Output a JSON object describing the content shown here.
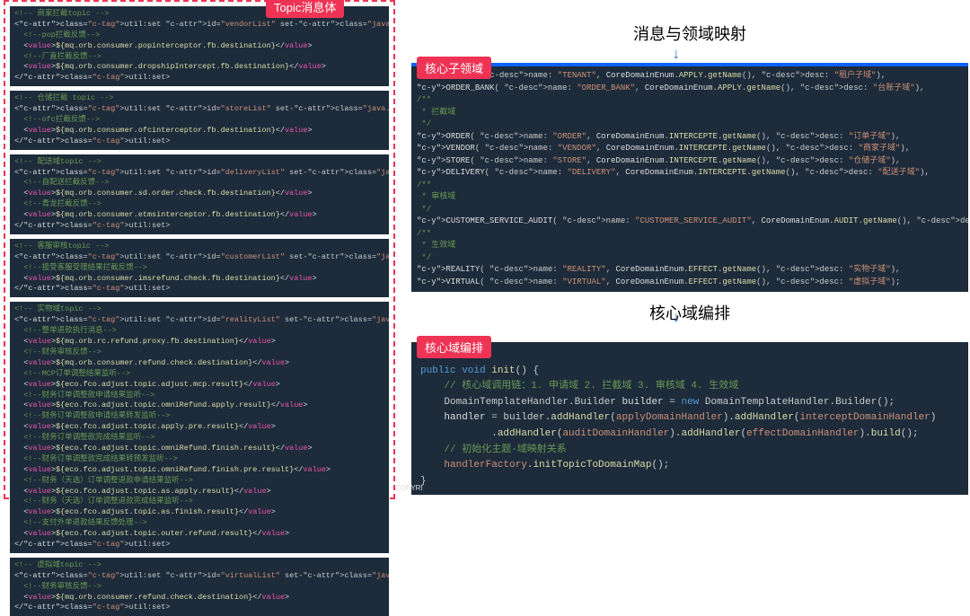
{
  "labels": {
    "topic": "Topic消息体",
    "subdomain": "核心子领域",
    "orchestration": "核心域编排"
  },
  "titles": {
    "mapping": "消息与领域映射",
    "orchestration": "核心域编排"
  },
  "left_blocks": [
    {
      "lines": [
        {
          "kind": "cmt",
          "text": "<!-- 商家拦截topic -->"
        },
        {
          "kind": "tag",
          "text": "<util:set id=\"vendorList\" set-class=\"java.util.HashSet\">"
        },
        {
          "kind": "cmt",
          "text": "  <!--pop拦截反馈-->"
        },
        {
          "kind": "val",
          "text": "  <value>${mq.orb.consumer.popinterceptor.fb.destination}</value>"
        },
        {
          "kind": "cmt",
          "text": "  <!--厂直拦截反馈-->"
        },
        {
          "kind": "val",
          "text": "  <value>${mq.orb.consumer.dropshipIntercept.fb.destination}</value>"
        },
        {
          "kind": "tag",
          "text": "</util:set>"
        }
      ]
    },
    {
      "lines": [
        {
          "kind": "cmt",
          "text": "<!-- 仓储拦截 topic -->"
        },
        {
          "kind": "tag",
          "text": "<util:set id=\"storeList\" set-class=\"java.util.HashSet\">"
        },
        {
          "kind": "cmt",
          "text": "  <!--ofc拦截反馈-->"
        },
        {
          "kind": "val",
          "text": "  <value>${mq.orb.consumer.ofcinterceptor.fb.destination}</value>"
        },
        {
          "kind": "tag",
          "text": "</util:set>"
        }
      ]
    },
    {
      "lines": [
        {
          "kind": "cmt",
          "text": "<!-- 配送域topic -->"
        },
        {
          "kind": "tag",
          "text": "<util:set id=\"deliveryList\" set-class=\"java.util.HashSet\">"
        },
        {
          "kind": "cmt",
          "text": "  <!--自配送拦截反馈-->"
        },
        {
          "kind": "val",
          "text": "  <value>${mq.orb.consumer.sd.order.check.fb.destination}</value>"
        },
        {
          "kind": "cmt",
          "text": "  <!--青龙拦截反馈-->"
        },
        {
          "kind": "val",
          "text": "  <value>${mq.orb.consumer.etmsinterceptor.fb.destination}</value>"
        },
        {
          "kind": "tag",
          "text": "</util:set>"
        }
      ]
    },
    {
      "lines": [
        {
          "kind": "cmt",
          "text": "<!-- 客服审核topic -->"
        },
        {
          "kind": "tag",
          "text": "<util:set id=\"customerList\" set-class=\"java.util.HashSet\">"
        },
        {
          "kind": "cmt",
          "text": "  <!--接受客服受理结果拦截反馈-->"
        },
        {
          "kind": "val",
          "text": "  <value>${mq.orb.consumer.imsrefund.check.fb.destination}</value>"
        },
        {
          "kind": "tag",
          "text": "</util:set>"
        }
      ]
    },
    {
      "lines": [
        {
          "kind": "cmt",
          "text": "<!-- 实物域topic -->"
        },
        {
          "kind": "tag",
          "text": "<util:set id=\"realityList\" set-class=\"java.util.HashSet\">"
        },
        {
          "kind": "cmt",
          "text": "  <!--整单退款执行消息-->"
        },
        {
          "kind": "val",
          "text": "  <value>${mq.orb.rc.refund.proxy.fb.destination}</value>"
        },
        {
          "kind": "cmt",
          "text": "  <!--财务审核反馈-->"
        },
        {
          "kind": "val",
          "text": "  <value>${mq.orb.consumer.refund.check.destination}</value>"
        },
        {
          "kind": "cmt",
          "text": "  <!--MCP订单调整结果监听-->"
        },
        {
          "kind": "val",
          "text": "  <value>${eco.fco.adjust.topic.adjust.mcp.result}</value>"
        },
        {
          "kind": "cmt",
          "text": "  <!--财务订单调整款申请结果监听-->"
        },
        {
          "kind": "val",
          "text": "  <value>${eco.fco.adjust.topic.omniRefund.apply.result}</value>"
        },
        {
          "kind": "cmt",
          "text": "  <!--财务订单调整款申请结果转发监听-->"
        },
        {
          "kind": "val",
          "text": "  <value>${eco.fco.adjust.topic.apply.pre.result}</value>"
        },
        {
          "kind": "cmt",
          "text": "  <!--财务订单调整款完成结果监听-->"
        },
        {
          "kind": "val",
          "text": "  <value>${eco.fco.adjust.topic.omniRefund.finish.result}</value>"
        },
        {
          "kind": "cmt",
          "text": "  <!--财务订单调整款完成结果转预发监听-->"
        },
        {
          "kind": "val",
          "text": "  <value>${eco.fco.adjust.topic.omniRefund.finish.pre.result}</value>"
        },
        {
          "kind": "cmt",
          "text": "  <!--财务（天选）订单调整退款申请结果监听-->"
        },
        {
          "kind": "val",
          "text": "  <value>${eco.fco.adjust.topic.as.apply.result}</value>"
        },
        {
          "kind": "cmt",
          "text": "  <!--财务（天选）订单调整退款完成结果监听-->"
        },
        {
          "kind": "val",
          "text": "  <value>${eco.fco.adjust.topic.as.finish.result}</value>"
        },
        {
          "kind": "cmt",
          "text": "  <!--支付外单退款结果反馈处理-->"
        },
        {
          "kind": "val",
          "text": "  <value>${eco.fco.adjust.topic.outer.refund.result}</value>"
        },
        {
          "kind": "tag",
          "text": "</util:set>"
        }
      ]
    },
    {
      "lines": [
        {
          "kind": "cmt",
          "text": "<!-- 虚拟域topic -->"
        },
        {
          "kind": "tag",
          "text": "<util:set id=\"virtualList\" set-class=\"java.util.HashSet\">"
        },
        {
          "kind": "cmt",
          "text": "  <!--财务审核反馈-->"
        },
        {
          "kind": "val",
          "text": "  <value>${mq.orb.consumer.refund.check.destination}</value>"
        },
        {
          "kind": "tag",
          "text": "</util:set>"
        }
      ]
    }
  ],
  "subdomain_code": [
    {
      "t": "TENANT( name: \"TENANT\", CoreDomainEnum.APPLY.getName(), desc: \"租户子域\"),"
    },
    {
      "t": "ORDER_BANK( name: \"ORDER_BANK\", CoreDomainEnum.APPLY.getName(), desc: \"台账子域\"),"
    },
    {
      "t": "/**"
    },
    {
      "t": " * 拦截域"
    },
    {
      "t": " */"
    },
    {
      "t": "ORDER( name: \"ORDER\", CoreDomainEnum.INTERCEPTE.getName(), desc: \"订单子域\"),"
    },
    {
      "t": "VENDOR( name: \"VENDOR\", CoreDomainEnum.INTERCEPTE.getName(), desc: \"商家子域\"),"
    },
    {
      "t": "STORE( name: \"STORE\", CoreDomainEnum.INTERCEPTE.getName(), desc: \"仓储子域\"),"
    },
    {
      "t": "DELIVERY( name: \"DELIVERY\", CoreDomainEnum.INTERCEPTE.getName(), desc: \"配送子域\"),"
    },
    {
      "t": "/**"
    },
    {
      "t": " * 审核域"
    },
    {
      "t": " */"
    },
    {
      "t": "CUSTOMER_SERVICE_AUDIT( name: \"CUSTOMER_SERVICE_AUDIT\", CoreDomainEnum.AUDIT.getName(), desc: \"客服子域\"),"
    },
    {
      "t": "/**"
    },
    {
      "t": " * 生效域"
    },
    {
      "t": " */"
    },
    {
      "t": "REALITY( name: \"REALITY\", CoreDomainEnum.EFFECT.getName(), desc: \"实物子域\"),"
    },
    {
      "t": "VIRTUAL( name: \"VIRTUAL\", CoreDomainEnum.EFFECT.getName(), desc: \"虚拟子域\");"
    }
  ],
  "orch_code": {
    "l0": "struct",
    "l1": "public void init() {",
    "l2": "    // 核心域调用链：1. 申请域 2. 拦截域 3. 审核域 4. 生效域",
    "l3": "    DomainTemplateHandler.Builder builder = new DomainTemplateHandler.Builder();",
    "l4": "    handler = builder.addHandler(applyDomainHandler).addHandler(interceptDomainHandler)",
    "l5": "            .addHandler(auditDomainHandler).addHandler(effectDomainHandler).build();",
    "l6": "    // 初始化主题-域映射关系",
    "l7": "    handlerFactory.initTopicToDomainMap();",
    "l8": "}"
  },
  "watermark": "COPYRI"
}
